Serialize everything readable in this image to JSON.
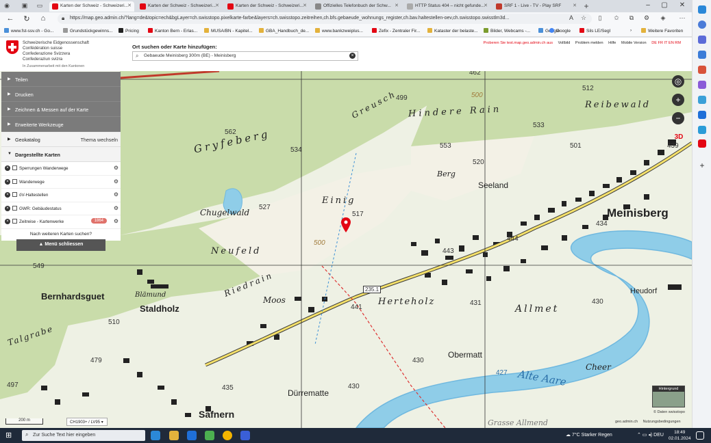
{
  "browser": {
    "tabs": [
      {
        "label": "Karten der Schweiz - Schweizeri..."
      },
      {
        "label": "Karten der Schweiz - Schweizeri..."
      },
      {
        "label": "Karten der Schweiz - Schweizeri..."
      },
      {
        "label": "Offizielles Telefonbuch der Schw..."
      },
      {
        "label": "HTTP Status 404 – nicht gefunde..."
      },
      {
        "label": "SRF 1 - Live - TV - Play SRF"
      }
    ],
    "url": "https://map.geo.admin.ch/?lang=de&topic=ech&bgLayer=ch.swisstopo.pixelkarte-farbe&layers=ch.swisstopo.zeitreihen,ch.bfs.gebaeude_wohnungs_register,ch.bav.haltestellen-oev,ch.swisstopo.swisstlm3d...",
    "favorites": [
      "www.fst-ssv.ch - Go...",
      "Grundstückgewinns...",
      "Pricing",
      "Kanton Bern - Erlas...",
      "MUSA/BN - Kapitel...",
      "GBA_Handbuch_de...",
      "www.bankzweiplus...",
      "Zefix - Zentraler Fir...",
      "Kataster der belaste...",
      "Bilder, Webcams -...",
      "Google",
      "Sils LE/Segl"
    ],
    "favorites_more": "Weitere Favoriten"
  },
  "header": {
    "confed": [
      "Schweizerische Eidgenossenschaft",
      "Confédération suisse",
      "Confederazione Svizzera",
      "Confederaziun svizra"
    ],
    "partner": "In Zusammenarbeit mit den Kantonen",
    "search_title": "Ort suchen oder Karte hinzufügen:",
    "search_value": "Gebaeude Meinisberg 300m (BE) - Meinisberg",
    "links": [
      "Proberen Sie test.map.geo.admin.ch aus",
      "Vollbild",
      "Problem melden",
      "Hilfe",
      "Mobile Version",
      "DE FR IT EN RM"
    ]
  },
  "panel": {
    "items": [
      "Teilen",
      "Drucken",
      "Zeichnen & Messen auf der Karte",
      "Erweiterte Werkzeuge"
    ],
    "geocatalog": "Geokatalog",
    "theme_switch": "Thema wechseln",
    "shown_maps": "Dargestellte Karten",
    "layers": [
      {
        "label": "Sperrungen Wanderwege"
      },
      {
        "label": "Wanderwege"
      },
      {
        "label": "öV-Haltestellen"
      },
      {
        "label": "GWR: Gebäudestatus"
      },
      {
        "label": "Zeitreise - Kartenwerke",
        "badge": "1864"
      }
    ],
    "more_maps": "Nach weiteren Karten suchen?",
    "close_menu": "Menü schliessen"
  },
  "map": {
    "places": [
      "Meinisberg",
      "Bernhardsguet",
      "Staldholz",
      "Chugelwald",
      "Gryfeberg",
      "Neufeld",
      "Riedrain",
      "Moos",
      "Blämund",
      "Herteholz",
      "Allmet",
      "Obermatt",
      "Dürrematte",
      "Seeland",
      "Berg",
      "Einig",
      "Hindere Rain",
      "Reibewald",
      "Greusch",
      "Heudorf",
      "Cheer",
      "Alte Aare",
      "Talgrabe",
      "Safnern",
      "Grasse Allmend"
    ],
    "elevations": [
      "462",
      "499",
      "512",
      "533",
      "562",
      "534",
      "553",
      "520",
      "501",
      "439",
      "517",
      "527",
      "434",
      "444",
      "443",
      "549",
      "510",
      "479",
      "497",
      "441",
      "431",
      "430",
      "430",
      "435",
      "430",
      "427",
      "235.1",
      "500",
      "500"
    ],
    "scale": "200 m",
    "crs": "CH1903+ / LV95",
    "background_label": "Hintergrund",
    "attribution": "© Daten swisstopo",
    "footer": [
      "geo.admin.ch",
      "Nutzungsbedingungen"
    ]
  },
  "taskbar": {
    "search_placeholder": "Zur Suche Text hier eingeben",
    "weather": "7°C  Starker Regen",
    "lang": "DEU",
    "time": "18:49",
    "date": "02.01.2024"
  },
  "colors": {
    "forest": "#c9dcaa",
    "water": "#8fcde8",
    "river": "#6fb8df",
    "road": "#f4e06a",
    "panel_dark": "#7b7b7b",
    "accent_red": "#e30613"
  }
}
